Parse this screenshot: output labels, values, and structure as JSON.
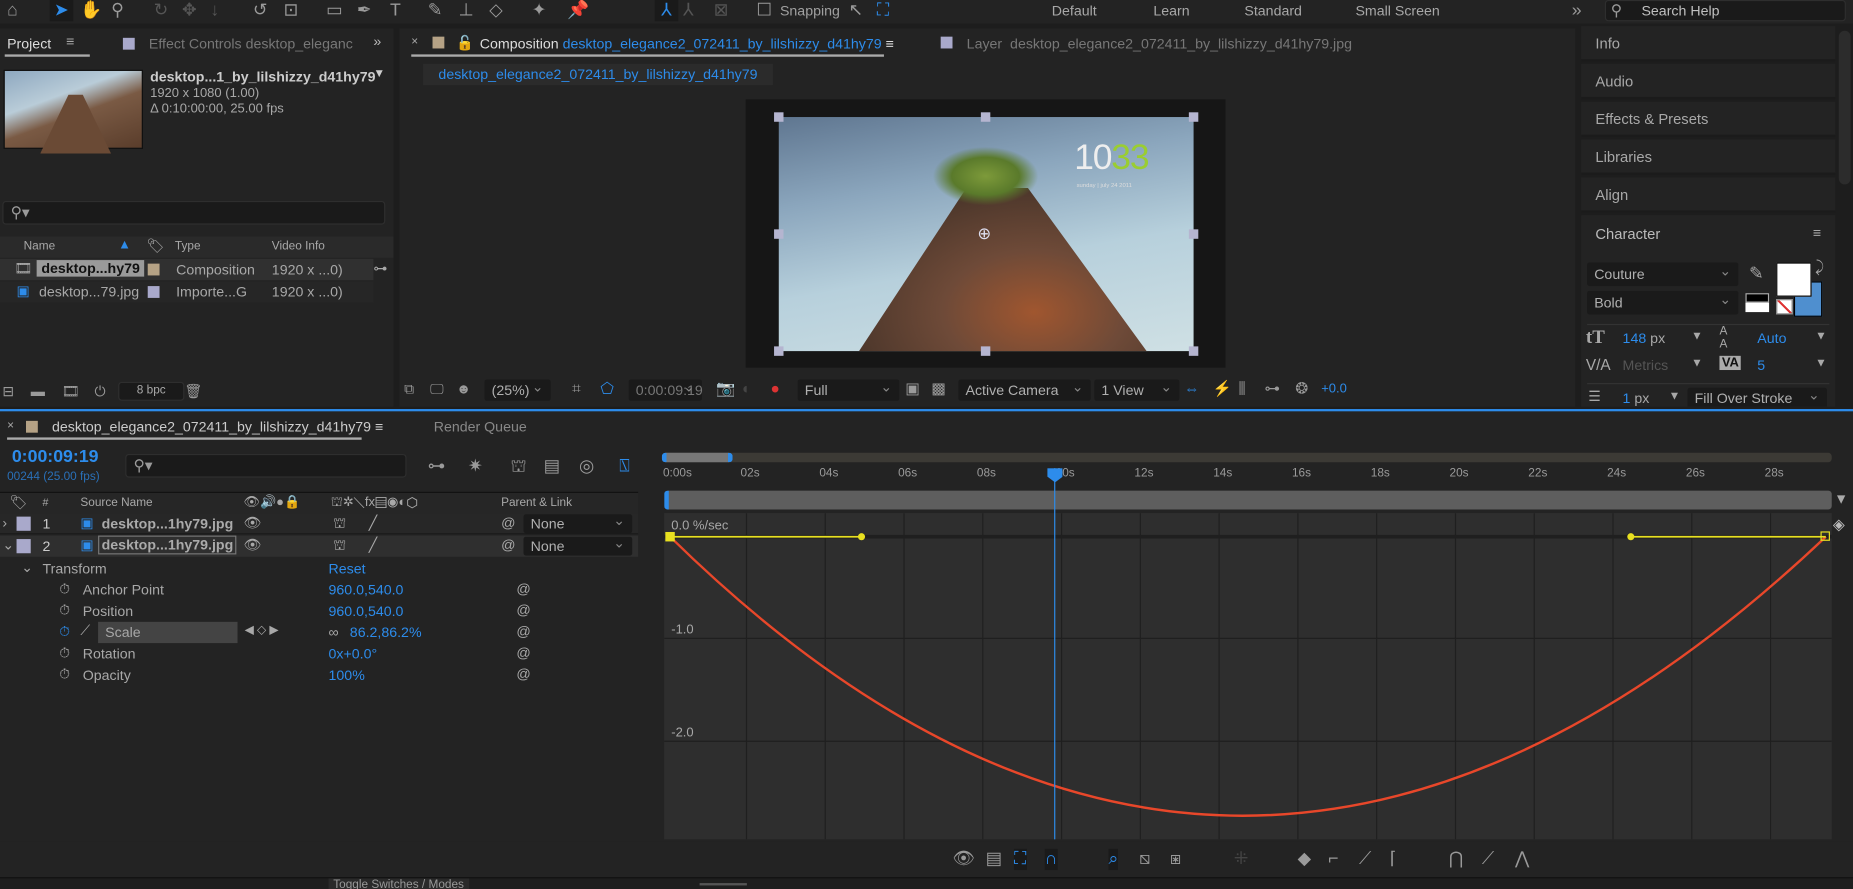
{
  "toolbar": {
    "snapping_label": "Snapping",
    "workspaces": [
      "Default",
      "Learn",
      "Standard",
      "Small Screen"
    ],
    "search_placeholder": "Search Help"
  },
  "project": {
    "tab_label": "Project",
    "effect_controls_label": "Effect Controls desktop_eleganc",
    "selected_name": "desktop...1_by_lilshizzy_d41hy79",
    "dimensions": "1920 x 1080 (1.00)",
    "duration": "Δ 0:10:00:00, 25.00 fps",
    "columns": [
      "Name",
      "Type",
      "Video Info"
    ],
    "items": [
      {
        "name": "desktop...hy79",
        "type": "Composition",
        "info": "1920 x ...0)",
        "color": "#b5a285"
      },
      {
        "name": "desktop...79.jpg",
        "type": "Importe...G",
        "info": "1920 x ...0)",
        "color": "#a9a9cb"
      }
    ],
    "bpc": "8 bpc"
  },
  "viewer": {
    "comp_tab_prefix": "Composition",
    "comp_name": "desktop_elegance2_072411_by_lilshizzy_d41hy79",
    "layer_tab_prefix": "Layer",
    "layer_name": "desktop_elegance2_072411_by_lilshizzy_d41hy79.jpg",
    "subtab": "desktop_elegance2_072411_by_lilshizzy_d41hy79",
    "clock_white": "10",
    "clock_green": "33",
    "clock_date": "sunday | july 24 2011",
    "zoom": "(25%)",
    "timecode": "0:00:09:19",
    "resolution": "Full",
    "camera": "Active Camera",
    "views": "1 View",
    "exposure": "+0.0"
  },
  "right_panel": {
    "items": [
      "Info",
      "Audio",
      "Effects & Presets",
      "Libraries",
      "Align"
    ],
    "character": {
      "title": "Character",
      "font": "Couture",
      "style": "Bold",
      "size": "148",
      "size_unit": "px",
      "leading": "Auto",
      "kerning": "Metrics",
      "tracking": "5",
      "stroke_width": "1",
      "stroke_unit": "px",
      "stroke_mode": "Fill Over Stroke"
    }
  },
  "timeline": {
    "comp_tab": "desktop_elegance2_072411_by_lilshizzy_d41hy79",
    "render_queue": "Render Queue",
    "timecode": "0:00:09:19",
    "frame_info": "00244 (25.00 fps)",
    "col_num": "#",
    "col_source": "Source Name",
    "col_parent": "Parent & Link",
    "layers": [
      {
        "num": "1",
        "name": "desktop...1hy79.jpg",
        "parent": "None"
      },
      {
        "num": "2",
        "name": "desktop...1hy79.jpg",
        "parent": "None"
      }
    ],
    "transform_label": "Transform",
    "reset_label": "Reset",
    "props": [
      {
        "name": "Anchor Point",
        "value": "960.0,540.0"
      },
      {
        "name": "Position",
        "value": "960.0,540.0"
      },
      {
        "name": "Scale",
        "value": "86.2,86.2%"
      },
      {
        "name": "Rotation",
        "value": "0x+0.0°"
      },
      {
        "name": "Opacity",
        "value": "100%"
      }
    ],
    "ruler": [
      "0:00s",
      "02s",
      "04s",
      "06s",
      "08s",
      "10s",
      "12s",
      "14s",
      "16s",
      "18s",
      "20s",
      "22s",
      "24s",
      "26s",
      "28s"
    ],
    "graph_labels": [
      "0.0 %/sec",
      "-1.0",
      "-2.0"
    ],
    "toggle_label": "Toggle Switches / Modes",
    "playhead_seconds": 9.76,
    "colors": {
      "curve": "#e8472a",
      "baseline": "#e8e020",
      "accent": "#2d8ceb"
    }
  }
}
